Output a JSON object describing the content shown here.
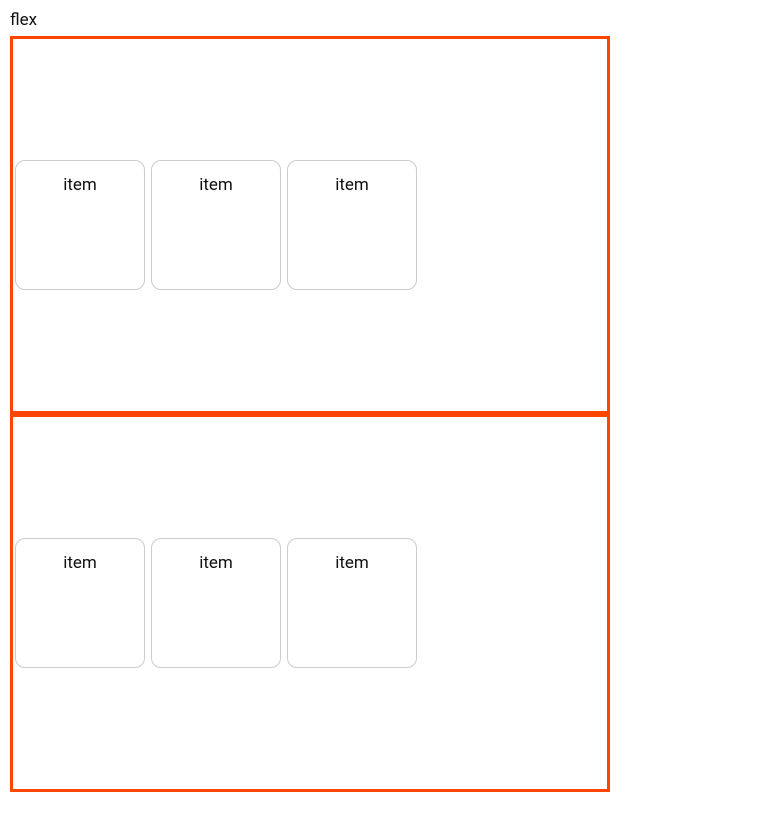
{
  "page": {
    "label": "flex"
  },
  "containers": [
    {
      "items": [
        {
          "label": "item"
        },
        {
          "label": "item"
        },
        {
          "label": "item"
        }
      ]
    },
    {
      "items": [
        {
          "label": "item"
        },
        {
          "label": "item"
        },
        {
          "label": "item"
        }
      ]
    }
  ],
  "colors": {
    "container_border": "#ff4500",
    "item_border": "#cccccc"
  }
}
